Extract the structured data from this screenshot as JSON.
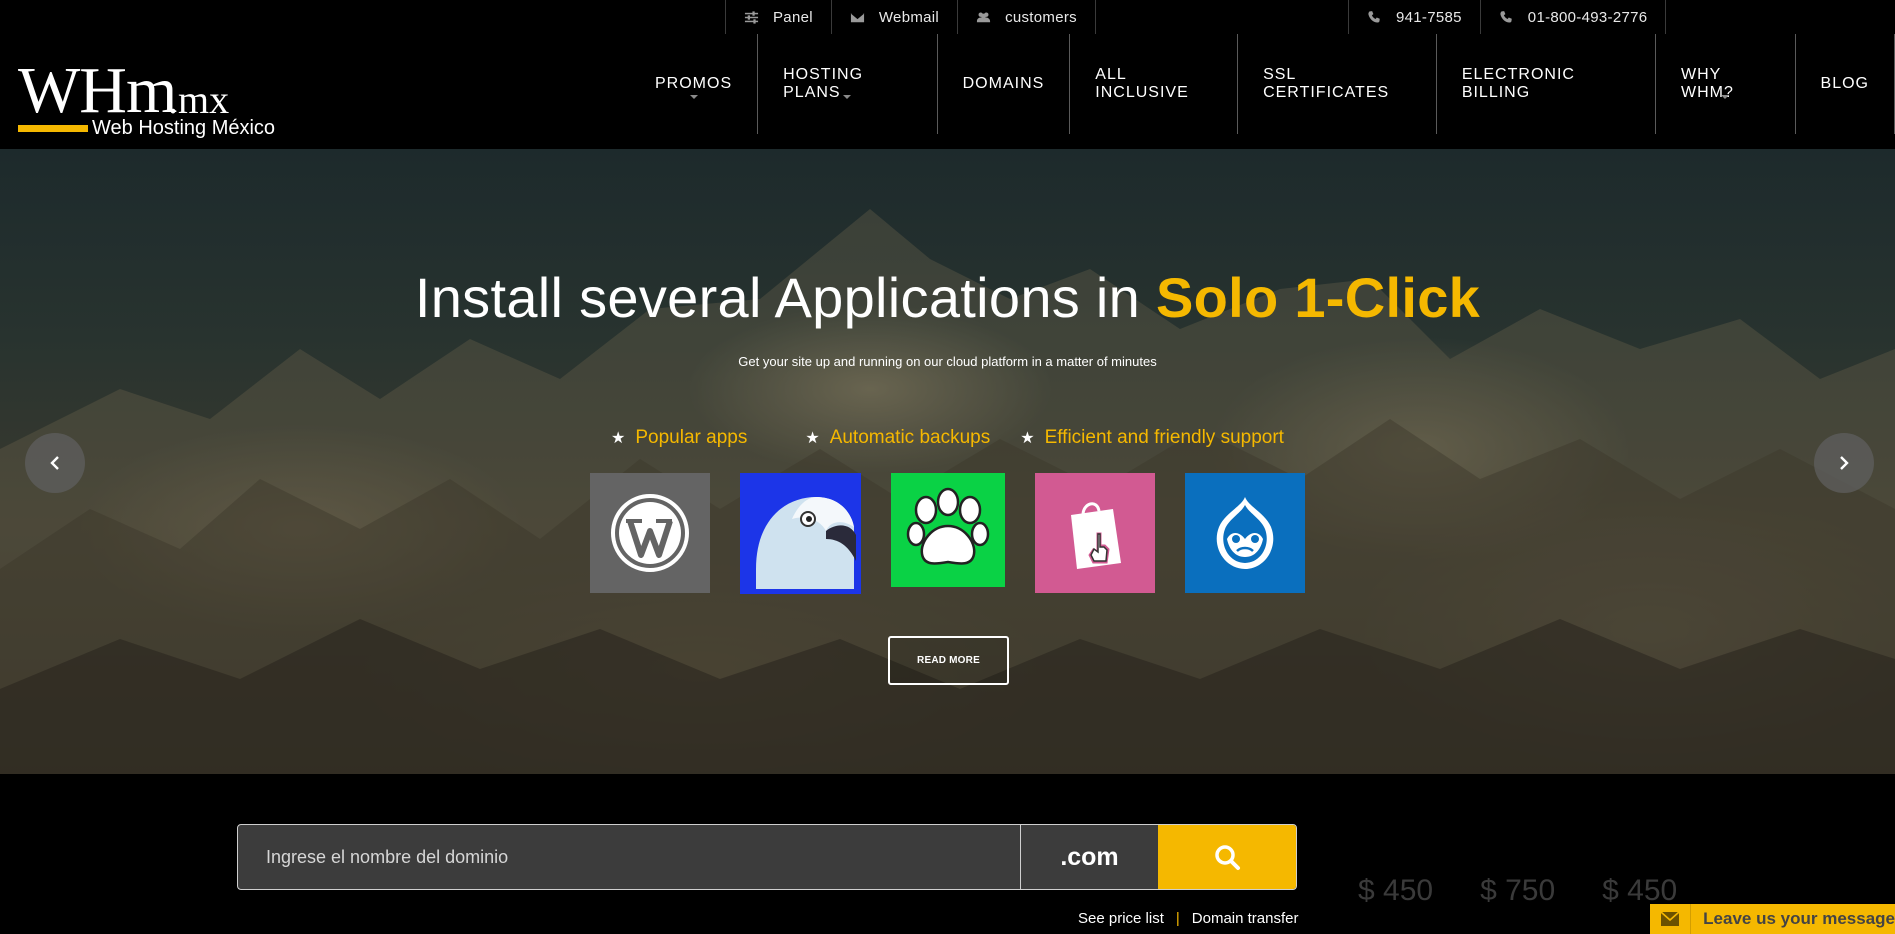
{
  "topbar": {
    "left": [
      {
        "label": "Panel",
        "icon": "sliders-icon"
      },
      {
        "label": "Webmail",
        "icon": "envelope-icon"
      },
      {
        "label": "customers",
        "icon": "users-icon"
      }
    ],
    "right": [
      {
        "label": "941-7585",
        "icon": "phone-icon"
      },
      {
        "label": "01-800-493-2776",
        "icon": "phone-icon"
      }
    ]
  },
  "logo": {
    "main": "WHm",
    "tld": ".mx",
    "sub": "Web Hosting México"
  },
  "nav": [
    {
      "label": "PROMOS",
      "dropdown": true
    },
    {
      "label": "HOSTING PLANS",
      "dropdown": true
    },
    {
      "label": "DOMAINS",
      "dropdown": false
    },
    {
      "label": "ALL INCLUSIVE",
      "dropdown": false
    },
    {
      "label": "SSL CERTIFICATES",
      "dropdown": false
    },
    {
      "label": "ELECTRONIC BILLING",
      "dropdown": false
    },
    {
      "label": "WHY WHM?",
      "dropdown": true
    },
    {
      "label": "BLOG",
      "dropdown": false
    }
  ],
  "hero": {
    "title_main": "Install several Applications in ",
    "title_accent": "Solo 1-Click",
    "subtitle": "Get your site up and running on our cloud platform in a matter of minutes",
    "features": [
      "Popular apps",
      "Automatic backups",
      "Efficient and friendly support"
    ],
    "apps": [
      {
        "name": "wordpress-icon",
        "color": "#646464"
      },
      {
        "name": "parrot-icon",
        "color": "#1c35e8"
      },
      {
        "name": "paw-icon",
        "color": "#0ad245"
      },
      {
        "name": "shopping-bag-icon",
        "color": "#d25a92"
      },
      {
        "name": "drupal-icon",
        "color": "#0a6fbe"
      }
    ],
    "read_more": "READ MORE"
  },
  "search": {
    "placeholder": "Ingrese el nombre del dominio",
    "tld": ".com",
    "links": [
      "See price list",
      "Domain transfer"
    ],
    "separator": "|"
  },
  "prices": [
    "$ 450",
    "$ 750",
    "$ 450"
  ],
  "chat": {
    "label": "Leave us your message"
  },
  "colors": {
    "accent": "#f5b800",
    "background": "#000000"
  }
}
